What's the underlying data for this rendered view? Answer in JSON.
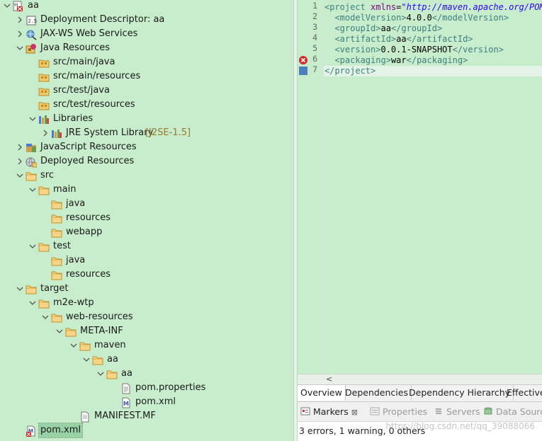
{
  "tree": [
    {
      "d": 0,
      "c": "v",
      "icon": "maven-project",
      "label": "aa"
    },
    {
      "d": 1,
      "c": ">",
      "icon": "descriptor",
      "label": "Deployment Descriptor: aa"
    },
    {
      "d": 1,
      "c": ">",
      "icon": "webservice",
      "label": "JAX-WS Web Services"
    },
    {
      "d": 1,
      "c": "v",
      "icon": "java-resources",
      "label": "Java Resources"
    },
    {
      "d": 2,
      "c": "",
      "icon": "package-folder",
      "label": "src/main/java"
    },
    {
      "d": 2,
      "c": "",
      "icon": "package-folder",
      "label": "src/main/resources"
    },
    {
      "d": 2,
      "c": "",
      "icon": "package-folder",
      "label": "src/test/java"
    },
    {
      "d": 2,
      "c": "",
      "icon": "package-folder",
      "label": "src/test/resources"
    },
    {
      "d": 2,
      "c": "v",
      "icon": "library",
      "label": "Libraries"
    },
    {
      "d": 3,
      "c": ">",
      "icon": "library",
      "label": "JRE System Library",
      "dec": "[J2SE-1.5]"
    },
    {
      "d": 1,
      "c": ">",
      "icon": "js-resources",
      "label": "JavaScript Resources"
    },
    {
      "d": 1,
      "c": ">",
      "icon": "globe",
      "label": "Deployed Resources"
    },
    {
      "d": 1,
      "c": "v",
      "icon": "folder",
      "label": "src"
    },
    {
      "d": 2,
      "c": "v",
      "icon": "folder",
      "label": "main"
    },
    {
      "d": 3,
      "c": "",
      "icon": "folder",
      "label": "java"
    },
    {
      "d": 3,
      "c": "",
      "icon": "folder",
      "label": "resources"
    },
    {
      "d": 3,
      "c": "",
      "icon": "folder",
      "label": "webapp"
    },
    {
      "d": 2,
      "c": "v",
      "icon": "folder",
      "label": "test"
    },
    {
      "d": 3,
      "c": "",
      "icon": "folder",
      "label": "java"
    },
    {
      "d": 3,
      "c": "",
      "icon": "folder",
      "label": "resources"
    },
    {
      "d": 1,
      "c": "v",
      "icon": "folder",
      "label": "target"
    },
    {
      "d": 2,
      "c": "v",
      "icon": "folder",
      "label": "m2e-wtp"
    },
    {
      "d": 3,
      "c": "v",
      "icon": "folder",
      "label": "web-resources"
    },
    {
      "d": 4,
      "c": "v",
      "icon": "folder",
      "label": "META-INF"
    },
    {
      "d": 5,
      "c": "v",
      "icon": "folder",
      "label": "maven"
    },
    {
      "d": 6,
      "c": "v",
      "icon": "folder",
      "label": "aa"
    },
    {
      "d": 7,
      "c": "v",
      "icon": "folder",
      "label": "aa"
    },
    {
      "d": 8,
      "c": "",
      "icon": "properties-file",
      "label": "pom.properties"
    },
    {
      "d": 8,
      "c": "",
      "icon": "maven-file",
      "label": "pom.xml"
    },
    {
      "d": 5,
      "c": "",
      "icon": "file",
      "label": "MANIFEST.MF"
    },
    {
      "d": 1,
      "c": "",
      "icon": "maven-file-error",
      "label": "pom.xml",
      "selected": true
    }
  ],
  "editor": {
    "lines": [
      {
        "n": "1",
        "marker": "",
        "parts": [
          [
            "t",
            "<project "
          ],
          [
            "a",
            "xmlns"
          ],
          [
            "tx",
            "="
          ],
          [
            "v",
            "\"http://maven.apache.org/POM/"
          ]
        ]
      },
      {
        "n": "2",
        "marker": "",
        "parts": [
          [
            "tx",
            "  "
          ],
          [
            "t",
            "<modelVersion>"
          ],
          [
            "tx",
            "4.0.0"
          ],
          [
            "t",
            "</modelVersion>"
          ]
        ]
      },
      {
        "n": "3",
        "marker": "",
        "parts": [
          [
            "tx",
            "  "
          ],
          [
            "t",
            "<groupId>"
          ],
          [
            "tx",
            "aa"
          ],
          [
            "t",
            "</groupId>"
          ]
        ]
      },
      {
        "n": "4",
        "marker": "",
        "parts": [
          [
            "tx",
            "  "
          ],
          [
            "t",
            "<artifactId>"
          ],
          [
            "tx",
            "aa"
          ],
          [
            "t",
            "</artifactId>"
          ]
        ]
      },
      {
        "n": "5",
        "marker": "",
        "parts": [
          [
            "tx",
            "  "
          ],
          [
            "t",
            "<version>"
          ],
          [
            "tx",
            "0.0.1-SNAPSHOT"
          ],
          [
            "t",
            "</version>"
          ]
        ]
      },
      {
        "n": "6",
        "marker": "error",
        "parts": [
          [
            "tx",
            "  "
          ],
          [
            "t",
            "<packaging>"
          ],
          [
            "tx",
            "war"
          ],
          [
            "t",
            "</packaging>"
          ]
        ]
      },
      {
        "n": "7",
        "marker": "bookmark",
        "parts": [
          [
            "t",
            "</project>"
          ]
        ]
      }
    ]
  },
  "editor_tabs": [
    "Overview",
    "Dependencies",
    "Dependency Hierarchy",
    "Effective"
  ],
  "views": {
    "tabs": [
      {
        "label": "Markers",
        "icon": "markers-icon",
        "active": true,
        "close": "⊠"
      },
      {
        "label": "Properties",
        "icon": "properties-icon",
        "active": false
      },
      {
        "label": "Servers",
        "icon": "servers-icon",
        "active": false
      },
      {
        "label": "Data Sourc",
        "icon": "datasource-icon",
        "active": false
      }
    ],
    "status": "3 errors, 1 warning, 0 others"
  },
  "watermark": "https://blog.csdn.net/qq_39088066",
  "colors": {
    "background": "#c7edcc",
    "tag": "#3f7f7f",
    "attr": "#7f007f",
    "value": "#2a00ff"
  }
}
